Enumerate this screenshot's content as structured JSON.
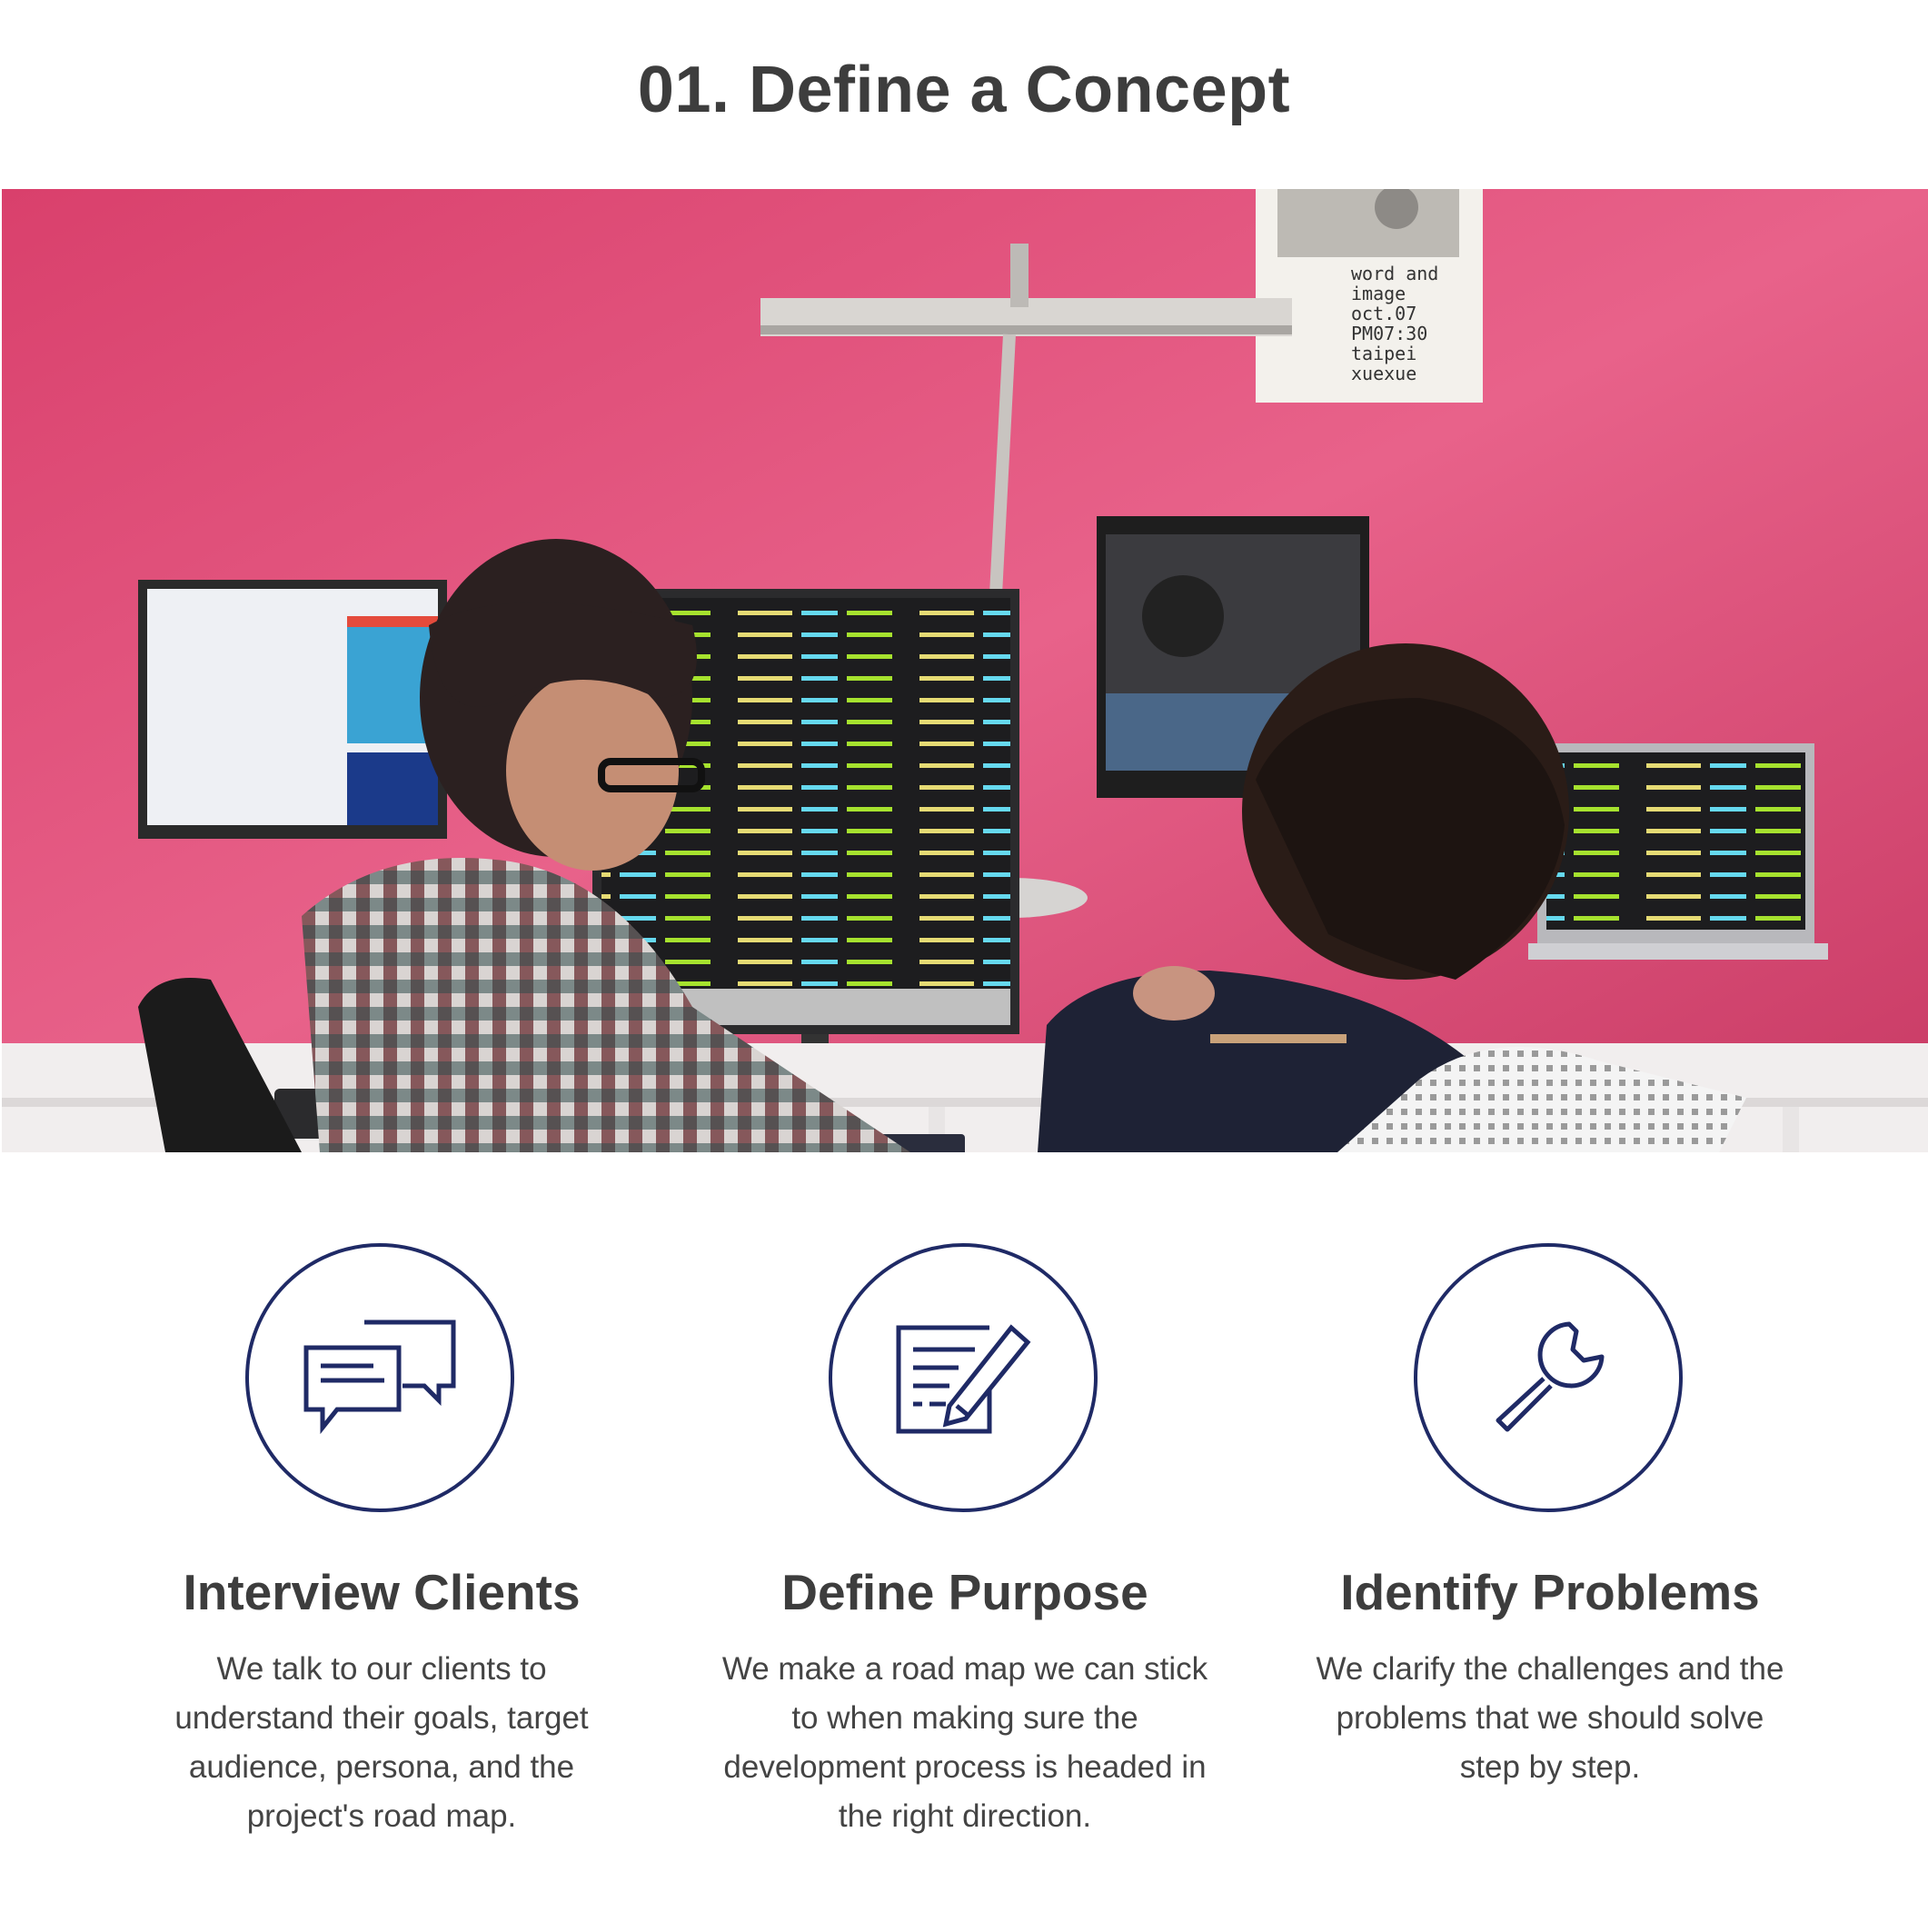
{
  "page": {
    "title": "01. Define a Concept"
  },
  "hero": {
    "poster_lines": [
      "word and",
      "image",
      "oct.07",
      "PM07:30",
      "taipei",
      "xuexue"
    ],
    "colors": {
      "wall": "#e4557e",
      "desk": "#f1eeee"
    }
  },
  "features": [
    {
      "icon": "chat-bubbles-icon",
      "title": "Interview Clients",
      "lines": [
        "We talk to our clients to",
        "understand their goals, target",
        "audience, persona, and the",
        "project's road map."
      ]
    },
    {
      "icon": "document-pencil-icon",
      "title": "Define Purpose",
      "lines": [
        "We make a road map we can stick",
        "to when making sure the",
        "development process is headed in",
        "the right direction."
      ]
    },
    {
      "icon": "wrench-icon",
      "title": "Identify Problems",
      "lines": [
        "We clarify the challenges and the",
        "problems that we should solve",
        "step by step."
      ]
    }
  ],
  "accent_color": "#1f2a66"
}
